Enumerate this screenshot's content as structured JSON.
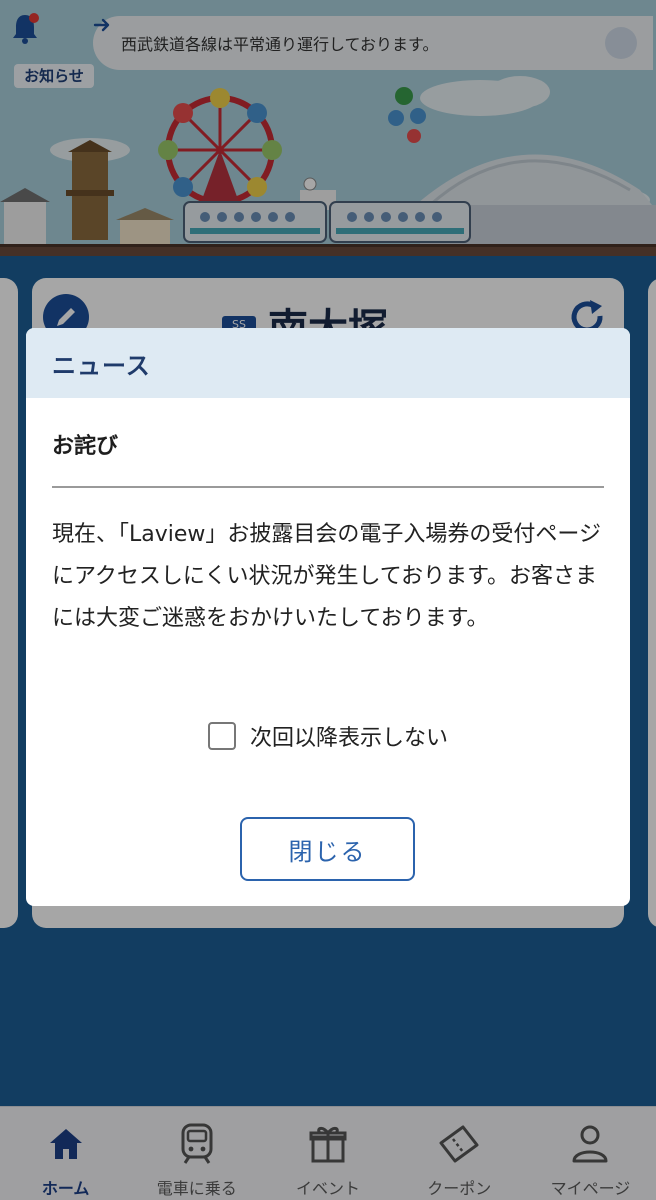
{
  "header": {
    "notice_label": "お知らせ",
    "ticker_text": "西武鉄道各線は平常通り運行しております。"
  },
  "station": {
    "badge": "SS",
    "name": "南大塚"
  },
  "dialog": {
    "title": "ニュース",
    "news_title": "お詫び",
    "news_body": "現在、「Laview」お披露目会の電子入場券の受付ページにアクセスしにくい状況が発生しております。お客さまには大変ご迷惑をおかけいたしております。",
    "checkbox_label": "次回以降表示しない",
    "checkbox_checked": false,
    "close_label": "閉じる"
  },
  "tabs": [
    {
      "label": "ホーム",
      "icon": "home-icon",
      "active": true
    },
    {
      "label": "電車に乗る",
      "icon": "train-icon",
      "active": false
    },
    {
      "label": "イベント",
      "icon": "gift-icon",
      "active": false
    },
    {
      "label": "クーポン",
      "icon": "ticket-icon",
      "active": false
    },
    {
      "label": "マイページ",
      "icon": "person-icon",
      "active": false
    }
  ],
  "colors": {
    "accent": "#1c4f9a",
    "dialog_header_bg": "#deeaf3",
    "close_button": "#2b63ad"
  }
}
